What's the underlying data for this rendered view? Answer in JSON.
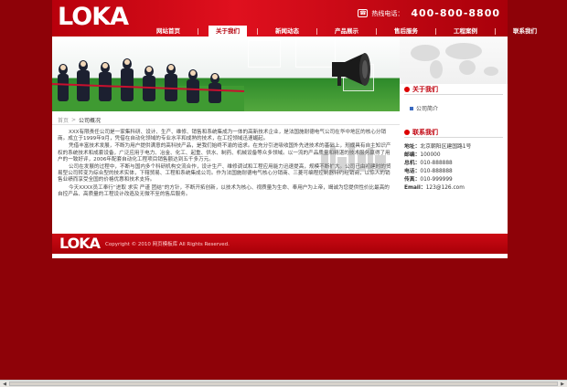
{
  "header": {
    "logo": "LOKA",
    "hotline_label": "热线电话：",
    "hotline_number": "400-800-8800"
  },
  "nav": [
    {
      "label": "网站首页",
      "active": false
    },
    {
      "label": "关于我们",
      "active": true
    },
    {
      "label": "新闻动态",
      "active": false
    },
    {
      "label": "产品展示",
      "active": false
    },
    {
      "label": "售后服务",
      "active": false
    },
    {
      "label": "工程案例",
      "active": false
    },
    {
      "label": "联系我们",
      "active": false
    }
  ],
  "breadcrumb": {
    "home": "首页",
    "sep": ">",
    "current": "公司概况"
  },
  "content": {
    "p1": "XXX有限责任公司是一家集科研、设计、生产、维修、销售和系统集成为一体的高新技术企业，是法国施耐德电气公司在华中地区的核心分销商。成立于1999年9月，凭借在自动化领域的专业水平和成熟的技术，在工控领域迅速崛起。",
    "p2": "凭借丰富技术发展，不断为用户提供满意的高科技产品，是我们始终不渝的追求。在充分引进吸收国外先进技术的基础上，形成具有自主知识产权的系统技术和成套设备，广泛应用于电力、冶金、化工、起重、供水、制药、机械设备等众多领域。以一流的产品质量和精湛的技术服务赢得了用户的一致好评，2006年配套自动化工程项目销售额达到五千多万元。",
    "p3": "公司在发展的过程中，不断与国内多个科研机构交流合作，设计生产、维修调试和工程应用能力迅速提高，规模不断扩大。公司已由初建时的贸易型公司转变为综合型的技术实体，下辖贸易、工程和系统集成公司。作为法国施耐德电气核心分销商、三菱可编程控制器特约经销商，以惊人的销售业绩而享受全国的价格优惠和技术支持。",
    "p4": "今天XXXX员工奉行“进取 求实 严谨 团结”的方针，不断开拓创新，以技术为核心、视质量为生命、奉用户为上帝，竭诚为您提供性价比最高的自控产品、高质量的工程设计改造及无微不至的售后服务。"
  },
  "sidebar": {
    "about_title": "关于我们",
    "about_link": "公司简介",
    "contact_title": "联系我们",
    "contacts": [
      {
        "label": "地址：",
        "value": "北京朝阳区建国路1号"
      },
      {
        "label": "邮编：",
        "value": "100000"
      },
      {
        "label": "总机：",
        "value": "010-888888"
      },
      {
        "label": "电话：",
        "value": "010-888888"
      },
      {
        "label": "传真：",
        "value": "010-999999"
      },
      {
        "label": "Email：",
        "value": "123@126.com"
      }
    ]
  },
  "footer": {
    "logo": "LOKA",
    "copyright": "Copyright © 2010 网页模板库 All Rights Reserved."
  },
  "colors": {
    "brand": "#c0000c",
    "background": "#8e0208"
  },
  "scrollbar": {
    "left_arrow": "◀",
    "right_arrow": "▶"
  }
}
